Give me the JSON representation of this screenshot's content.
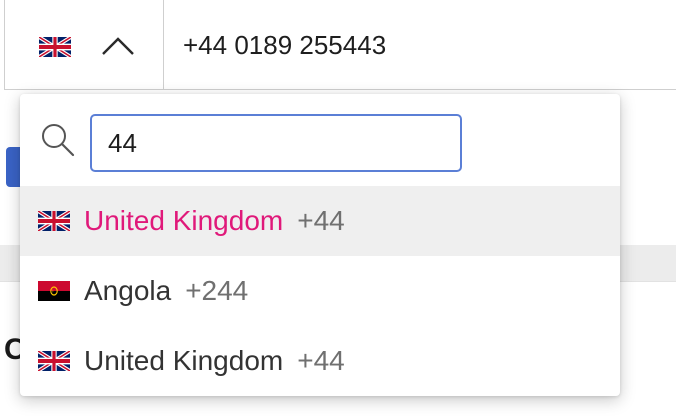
{
  "phone": {
    "value": "+44 0189 255443",
    "selected_flag": "uk-flag-icon"
  },
  "search": {
    "value": "44",
    "icon": "search-icon"
  },
  "options": [
    {
      "name": "United Kingdom",
      "code": "+44",
      "flag": "uk-flag-icon",
      "highlighted": true
    },
    {
      "name": "Angola",
      "code": "+244",
      "flag": "angola-flag-icon",
      "highlighted": false
    },
    {
      "name": "United Kingdom",
      "code": "+44",
      "flag": "uk-flag-icon",
      "highlighted": false
    }
  ],
  "colors": {
    "highlight_text": "#e0197a",
    "focus_border": "#5b7fd6",
    "highlight_bg": "#efefef"
  },
  "background": {
    "partial_letter": "C"
  }
}
